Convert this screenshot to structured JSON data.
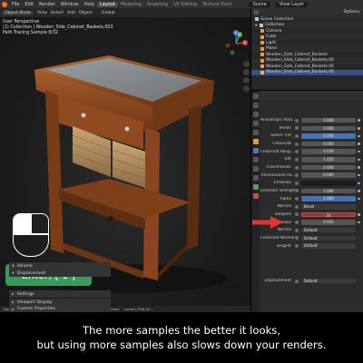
{
  "app": {
    "menu": [
      "File",
      "Edit",
      "Render",
      "Window",
      "Help"
    ],
    "workspaces": [
      "Layout",
      "Modeling",
      "Sculpting",
      "UV Editing",
      "Texture Paint"
    ],
    "active_workspace": "Layout",
    "scene_label": "Scene",
    "view_layer_label": "View Layer"
  },
  "viewport": {
    "header": {
      "mode": "Object Mode",
      "items": [
        "View",
        "Select",
        "Add",
        "Object"
      ],
      "transform": "Global"
    },
    "info": {
      "line1": "User Perspective",
      "line2": "(1) Collection | Wooden_Side_Cabinet_Baskets.003",
      "line3": "Path Tracing Sample 8/32"
    },
    "overlay_badge": "Enter, [ 1 ]",
    "gizmo": {
      "x": "X",
      "y": "Y",
      "z": "Z"
    },
    "status_bar": [
      "Object",
      "Move",
      "Rotate View",
      "Set 3D Cursor",
      "Use Nodes",
      "Select",
      "Lumen_Mild_sh..."
    ]
  },
  "outliner": {
    "header": [
      "Options"
    ],
    "rows": [
      {
        "label": "Scene Collection",
        "selected": false
      },
      {
        "label": "Collection",
        "selected": false
      },
      {
        "label": "Camera",
        "selected": false
      },
      {
        "label": "Cube",
        "selected": false
      },
      {
        "label": "Light",
        "selected": false
      },
      {
        "label": "Plane",
        "selected": false
      },
      {
        "label": "Wooden_Side_Cabinet_Baskets",
        "selected": false
      },
      {
        "label": "Wooden_Side_Cabinet_Baskets.00",
        "selected": false
      },
      {
        "label": "Wooden_Side_Cabinet_Baskets.00",
        "selected": false
      },
      {
        "label": "Wooden_Side_Cabinet_Baskets.00",
        "selected": true
      }
    ]
  },
  "properties": {
    "rows": [
      {
        "label": "Anisotropic Rota...",
        "value": "0.000",
        "style": "normal"
      },
      {
        "label": "Sheen",
        "value": "0.000",
        "style": "normal"
      },
      {
        "label": "Sheen Tint",
        "value": "0.500",
        "style": "blue"
      },
      {
        "label": "Clearcoat",
        "value": "0.000",
        "style": "normal"
      },
      {
        "label": "Clearcoat Roug...",
        "value": "0.030",
        "style": "normal"
      },
      {
        "label": "IOR",
        "value": "1.450",
        "style": "normal"
      },
      {
        "label": "Transmission",
        "value": "0.000",
        "style": "normal"
      },
      {
        "label": "Transmission Ro...",
        "value": "0.000",
        "style": "normal"
      },
      {
        "label": "Emission",
        "value": "",
        "style": "dark"
      },
      {
        "label": "Emission Strength",
        "value": "1.000",
        "style": "normal"
      },
      {
        "label": "Alpha",
        "value": "1.000",
        "style": "blue"
      },
      {
        "label": "Normal",
        "value": "Bevel",
        "style": "left"
      },
      {
        "label": "Samples",
        "value": "16",
        "style": "highlight"
      },
      {
        "label": "Radius",
        "value": "0.050",
        "style": "normal"
      },
      {
        "label": "Normal",
        "value": "Default",
        "style": "left"
      },
      {
        "label": "Clearcoat Normal",
        "value": "Default",
        "style": "left"
      },
      {
        "label": "Tangent",
        "value": "Default",
        "style": "left"
      }
    ],
    "sections": [
      {
        "label": "Volume",
        "expanded": true
      },
      {
        "label": "Displacement",
        "expanded": true
      },
      {
        "label": "Settings",
        "expanded": false
      },
      {
        "label": "Viewport Display",
        "expanded": false
      },
      {
        "label": "Custom Properties",
        "expanded": false
      }
    ],
    "displacement_row": {
      "label": "Displacement",
      "value": "Default"
    }
  },
  "caption": {
    "line1": "The more samples the better it looks,",
    "line2": "but using more samples also slows down your renders."
  },
  "colors": {
    "accent_blue": "#4772b3",
    "badge_green": "#3a9a5a",
    "highlight_red": "#e33333"
  }
}
